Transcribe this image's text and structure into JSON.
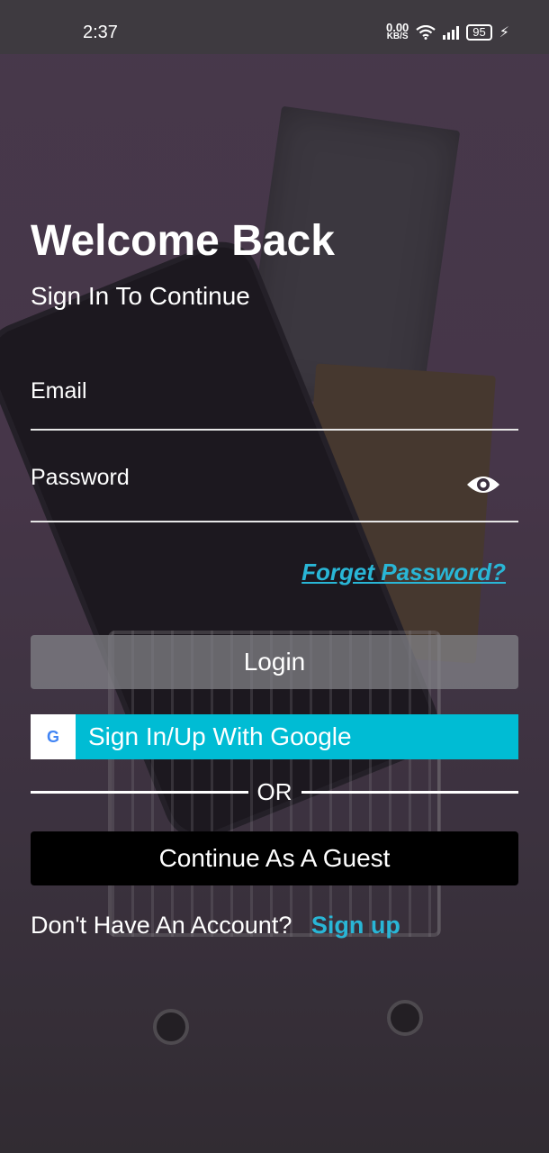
{
  "status_bar": {
    "time": "2:37",
    "net_speed_value": "0.00",
    "net_speed_unit": "KB/S",
    "battery": "95"
  },
  "header": {
    "title": "Welcome Back",
    "subtitle": "Sign In To Continue"
  },
  "form": {
    "email_label": "Email",
    "password_label": "Password",
    "forgot_label": "Forget Password?"
  },
  "buttons": {
    "login": "Login",
    "google": "Sign In/Up With Google",
    "or": "OR",
    "guest": "Continue As A Guest"
  },
  "footer": {
    "prompt": "Don't Have An Account?",
    "signup": "Sign up"
  },
  "colors": {
    "accent": "#29b6d6",
    "google_button": "#00bcd4",
    "guest_button": "#000000"
  }
}
